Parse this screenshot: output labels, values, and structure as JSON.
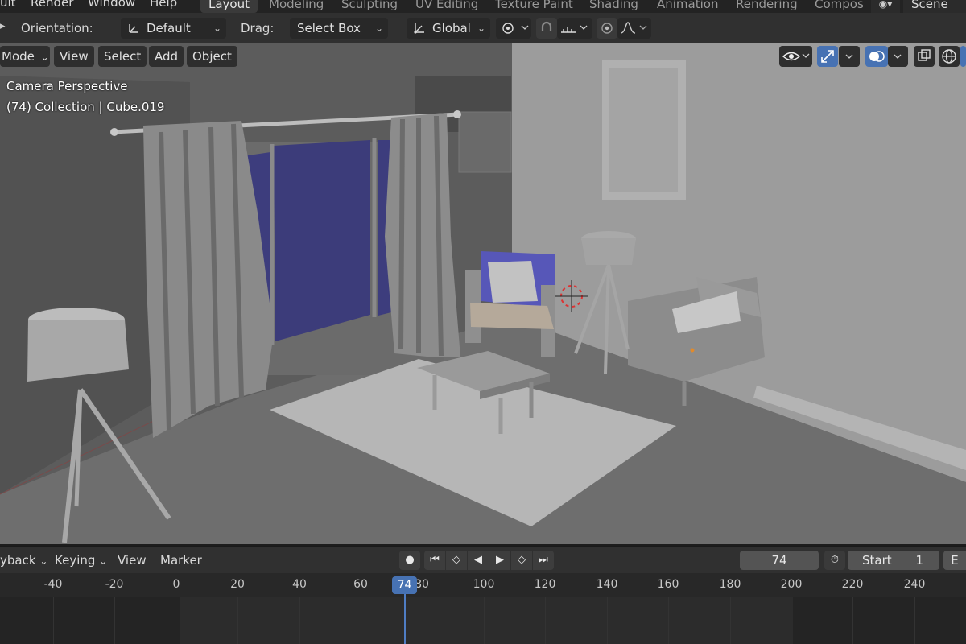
{
  "menus": [
    {
      "label": "uit"
    },
    {
      "label": "Render"
    },
    {
      "label": "Window"
    },
    {
      "label": "Help"
    }
  ],
  "workspaces": [
    {
      "label": "Layout",
      "active": true
    },
    {
      "label": "Modeling"
    },
    {
      "label": "Sculpting"
    },
    {
      "label": "UV Editing"
    },
    {
      "label": "Texture Paint"
    },
    {
      "label": "Shading"
    },
    {
      "label": "Animation"
    },
    {
      "label": "Rendering"
    },
    {
      "label": "Compos"
    }
  ],
  "scene_name": "Scene",
  "tool_header": {
    "orientation_label": "Orientation:",
    "orientation_value": "Default",
    "drag_label": "Drag:",
    "drag_value": "Select Box",
    "transform_space": "Global"
  },
  "viewport_header": {
    "mode": "Mode",
    "menus": [
      "View",
      "Select",
      "Add",
      "Object"
    ]
  },
  "viewport_overlay": {
    "view_name": "Camera Perspective",
    "collection_info": "(74) Collection | Cube.019"
  },
  "timeline": {
    "playback_label": "yback",
    "keying_label": "Keying",
    "view_label": "View",
    "marker_label": "Marker",
    "current_frame": "74",
    "start_label": "Start",
    "start_value": "1",
    "end_label": "E",
    "ruler_ticks": [
      "-40",
      "-20",
      "0",
      "20",
      "40",
      "60",
      "80",
      "100",
      "120",
      "140",
      "160",
      "180",
      "200",
      "220",
      "240"
    ],
    "playhead_frame": "74"
  },
  "colors": {
    "accent": "#4772b3",
    "window_glass": "#3b3b7a",
    "chair_cushion": "#5757b8"
  }
}
